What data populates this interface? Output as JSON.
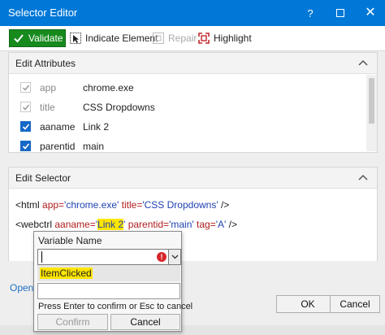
{
  "window": {
    "title": "Selector Editor",
    "help_glyph": "?",
    "close_glyph": "✕"
  },
  "toolbar": {
    "validate_label": "Validate",
    "indicate_label": "Indicate Element",
    "repair_label": "Repair",
    "highlight_label": "Highlight",
    "validate_color": "#178a1e"
  },
  "edit_attributes": {
    "header": "Edit Attributes",
    "rows": [
      {
        "name": "app",
        "value": "chrome.exe",
        "checked": true,
        "enabled": false
      },
      {
        "name": "title",
        "value": "CSS Dropdowns",
        "checked": true,
        "enabled": false
      },
      {
        "name": "aaname",
        "value": "Link 2",
        "checked": true,
        "enabled": true
      },
      {
        "name": "parentid",
        "value": "main",
        "checked": true,
        "enabled": true
      }
    ]
  },
  "edit_selector": {
    "header": "Edit Selector",
    "line1": {
      "open": "<html ",
      "app_key": "app=",
      "app_val": "'chrome.exe'",
      "title_key": " title=",
      "title_val": "'CSS Dropdowns'",
      "close": " />"
    },
    "line2": {
      "open": "<webctrl ",
      "aaname_key": "aaname=",
      "q1": "'",
      "aaname_val": "Link 2",
      "q2": "'",
      "parentid_key": " parentid=",
      "parentid_val": "'main'",
      "tag_key": " tag=",
      "tag_val": "'A'",
      "close": " />"
    }
  },
  "open_link": "Open",
  "dialog_buttons": {
    "ok": "OK",
    "cancel": "Cancel"
  },
  "popup": {
    "label": "Variable Name",
    "input_value": "",
    "error_glyph": "!",
    "suggestion": "ItemClicked",
    "hint": "Press Enter to confirm or Esc to cancel",
    "confirm": "Confirm",
    "cancel": "Cancel"
  }
}
